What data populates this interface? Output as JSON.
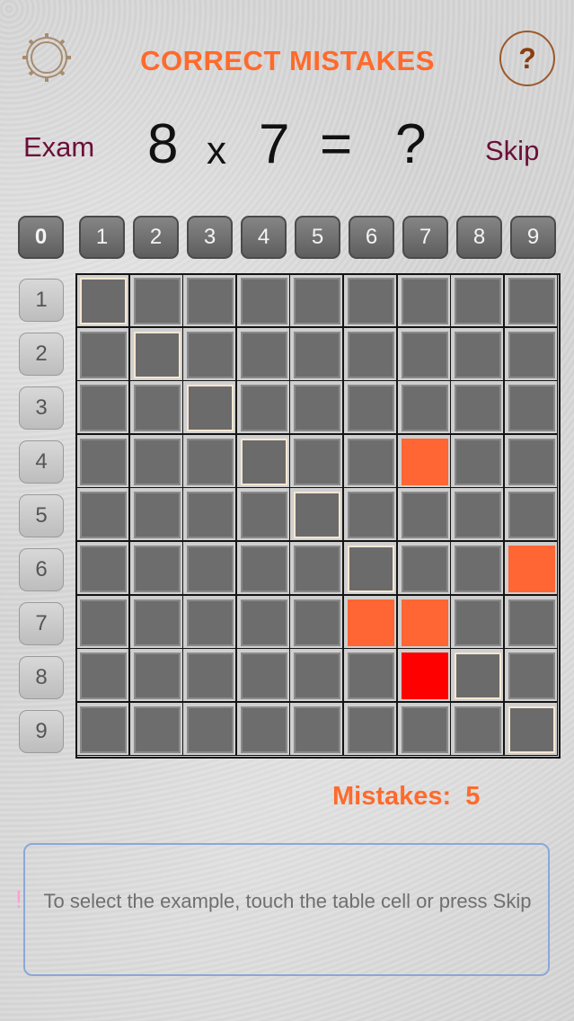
{
  "header": {
    "title": "CORRECT MISTAKES",
    "help_label": "?",
    "settings_icon": "gear-icon"
  },
  "equation": {
    "exam_label": "Exam",
    "skip_label": "Skip",
    "a": "8",
    "op": "x",
    "b": "7",
    "eq": "=",
    "result": "?"
  },
  "column_buttons": [
    "0",
    "1",
    "2",
    "3",
    "4",
    "5",
    "6",
    "7",
    "8",
    "9"
  ],
  "row_buttons": [
    "1",
    "2",
    "3",
    "4",
    "5",
    "6",
    "7",
    "8",
    "9"
  ],
  "grid": {
    "diagonal_cells": [
      [
        1,
        1
      ],
      [
        2,
        2
      ],
      [
        3,
        3
      ],
      [
        4,
        4
      ],
      [
        5,
        5
      ],
      [
        6,
        6
      ],
      [
        7,
        7
      ],
      [
        8,
        8
      ],
      [
        9,
        9
      ]
    ],
    "wrong_cells": [
      [
        4,
        7
      ],
      [
        6,
        9
      ],
      [
        7,
        6
      ],
      [
        7,
        7
      ]
    ],
    "active_cell": [
      8,
      7
    ]
  },
  "colors": {
    "accent": "#ff6a2c",
    "wrong": "#ff6633",
    "active": "#ff0000",
    "cell": "#6d6d6d"
  },
  "status": {
    "mistakes_label": "Mistakes:",
    "mistakes_count": "5"
  },
  "message": {
    "text": "To select the example, touch the table cell or press Skip",
    "marker": "!"
  }
}
